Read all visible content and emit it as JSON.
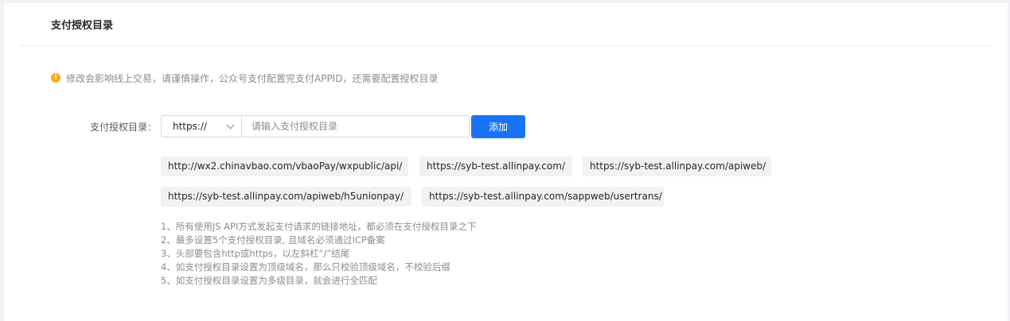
{
  "section": {
    "title": "支付授权目录"
  },
  "warning": {
    "icon": "exclamation-circle-icon",
    "icon_glyph": "!",
    "text": "修改会影响线上交易，请谨慎操作，公众号支付配置完支付APPID，还需要配置授权目录"
  },
  "form": {
    "label": "支付授权目录",
    "colon": ":",
    "protocol_selected": "https://",
    "input_value": "",
    "input_placeholder": "请输入支付授权目录",
    "add_button": "添加"
  },
  "directories": [
    "http://wx2.chinavbao.com/vbaoPay/wxpublic/api/",
    "https://syb-test.allinpay.com/",
    "https://syb-test.allinpay.com/apiweb/",
    "https://syb-test.allinpay.com/apiweb/h5unionpay/",
    "https://syb-test.allinpay.com/sappweb/usertrans/"
  ],
  "notes": [
    "1、所有使用JS API方式发起支付请求的链接地址，都必须在支付授权目录之下",
    "2、最多设置5个支付授权目录, 且域名必须通过ICP备案",
    "3、头部要包含http或https，以左斜杠“/”结尾",
    "4、如支付授权目录设置为顶级域名，那么只校验顶级域名，不校验后缀",
    "5、如支付授权目录设置为多级目录，就会进行全匹配"
  ],
  "colors": {
    "primary": "#1a73f5",
    "warning": "#faad14",
    "tag_bg": "#f2f2f2"
  }
}
